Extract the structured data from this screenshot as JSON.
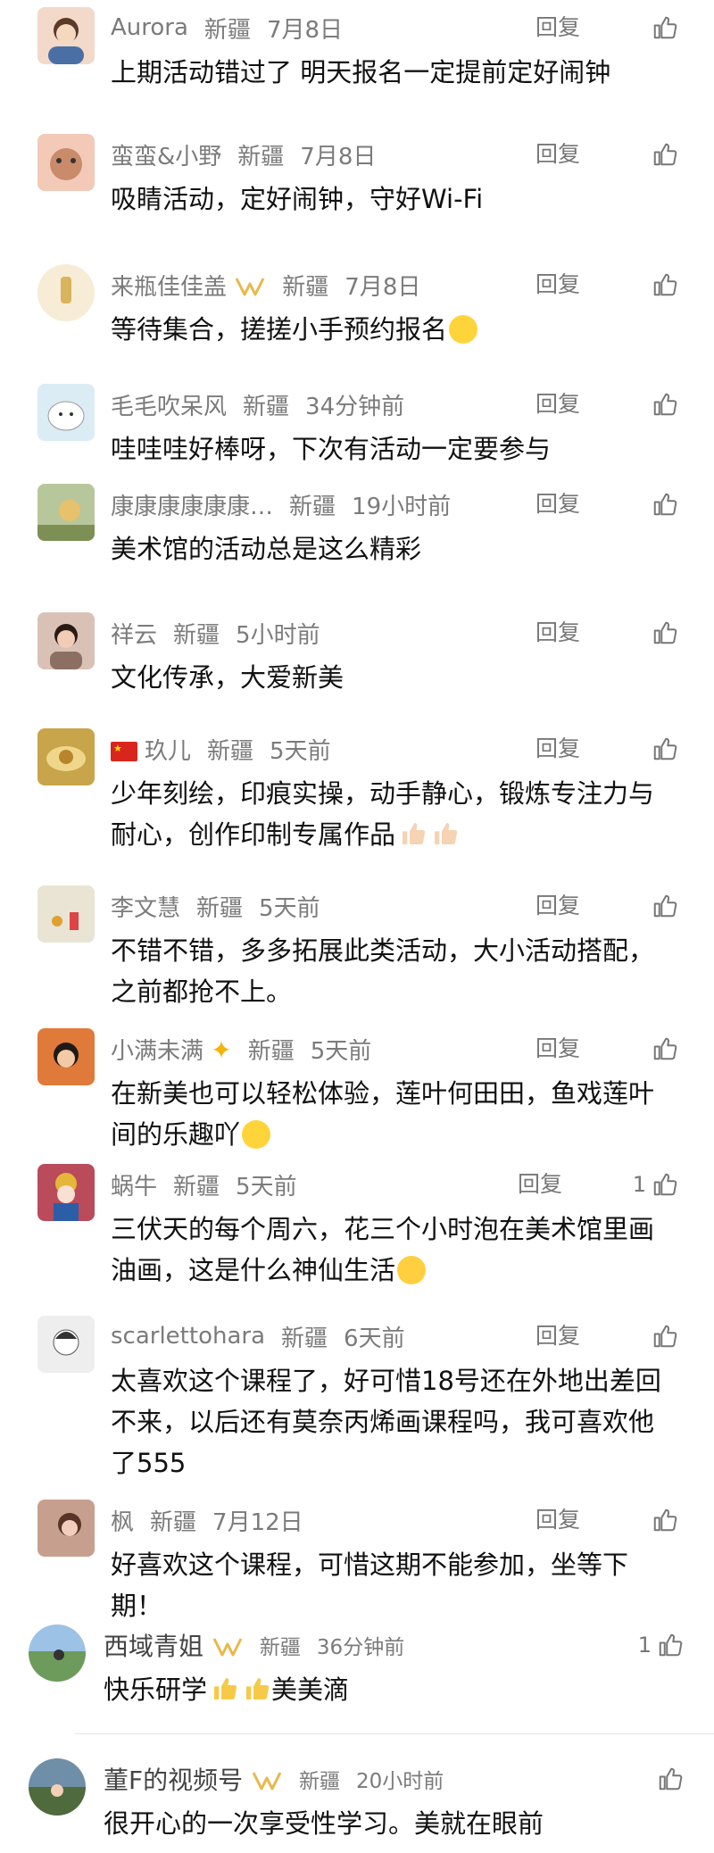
{
  "reply_label": "回复",
  "comments": [
    {
      "name": "Aurora",
      "region": "新疆",
      "time": "7月8日",
      "likes": "",
      "text": "上期活动错过了 明天报名一定提前定好闹钟",
      "avatar_color": "#f2d9c9"
    },
    {
      "name": "蛮蛮&小野",
      "region": "新疆",
      "time": "7月8日",
      "likes": "",
      "text": "吸睛活动，定好闹钟，守好Wi-Fi",
      "avatar_color": "#f3c9b8"
    },
    {
      "name": "来瓶佳佳盖",
      "region": "新疆",
      "time": "7月8日",
      "likes": "",
      "text": "等待集合，搓搓小手预约报名",
      "avatar_color": "#f7ecd6"
    },
    {
      "name": "毛毛吹呆风",
      "region": "新疆",
      "time": "34分钟前",
      "likes": "",
      "text": "哇哇哇好棒呀，下次有活动一定要参与",
      "avatar_color": "#dcecf5"
    },
    {
      "name": "康康康康康康…",
      "region": "新疆",
      "time": "19小时前",
      "likes": "",
      "text": "美术馆的活动总是这么精彩",
      "avatar_color": "#b8c79b"
    },
    {
      "name": "祥云",
      "region": "新疆",
      "time": "5小时前",
      "likes": "",
      "text": "文化传承，大爱新美",
      "avatar_color": "#d9c2b5"
    },
    {
      "name": "玖儿",
      "region": "新疆",
      "time": "5天前",
      "likes": "",
      "text": "少年刻绘，印痕实操，动手静心，锻炼专注力与耐心，创作印制专属作品",
      "avatar_color": "#c8a44a"
    },
    {
      "name": "李文慧",
      "region": "新疆",
      "time": "5天前",
      "likes": "",
      "text": "不错不错，多多拓展此类活动，大小活动搭配，之前都抢不上。",
      "avatar_color": "#e9e4d4"
    },
    {
      "name": "小满未满",
      "region": "新疆",
      "time": "5天前",
      "likes": "",
      "text": "在新美也可以轻松体验，莲叶何田田，鱼戏莲叶间的乐趣吖",
      "avatar_color": "#e07a3a"
    },
    {
      "name": "蜗牛",
      "region": "新疆",
      "time": "5天前",
      "likes": "1",
      "text": "三伏天的每个周六，花三个小时泡在美术馆里画油画，这是什么神仙生活",
      "avatar_color": "#b94b5a"
    },
    {
      "name": "scarlettohara",
      "region": "新疆",
      "time": "6天前",
      "likes": "",
      "text": "太喜欢这个课程了，好可惜18号还在外地出差回不来，以后还有莫奈丙烯画课程吗，我可喜欢他了555",
      "avatar_color": "#eeeeee"
    },
    {
      "name": "枫",
      "region": "新疆",
      "time": "7月12日",
      "likes": "",
      "text": "好喜欢这个课程，可惜这期不能参加，坐等下期！",
      "avatar_color": "#c79f8f"
    },
    {
      "name": "西域青姐",
      "region": "新疆",
      "time": "36分钟前",
      "likes": "1",
      "text": "快乐研学",
      "text2": "美美滴",
      "avatar_color": "#8fb0c7"
    },
    {
      "name": "董F的视频号",
      "region": "新疆",
      "time": "20小时前",
      "likes": "",
      "text": "很开心的一次享受性学习。美就在眼前",
      "avatar_color": "#6f8fa8"
    }
  ],
  "colors": {
    "meta": "#7b7b7b",
    "text": "#111111",
    "background": "#ffffff"
  },
  "icons": {
    "like": "thumbs-up-icon"
  }
}
